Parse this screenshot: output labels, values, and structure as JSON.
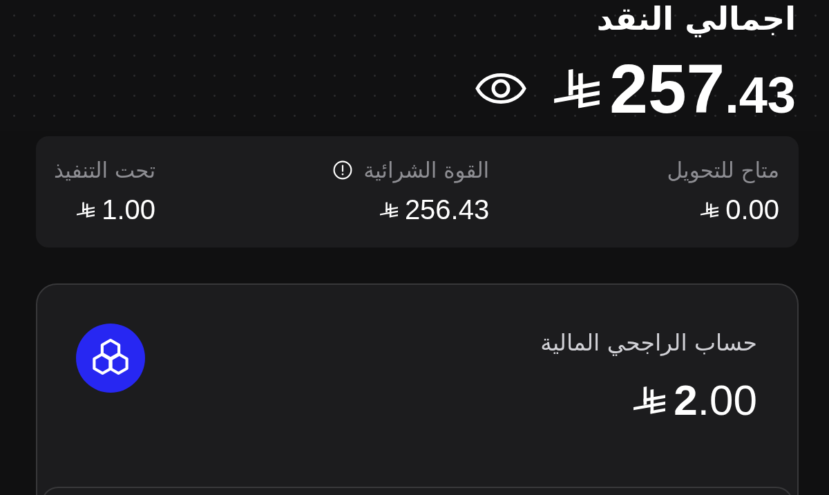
{
  "header": {
    "title": "اجمالي النقد",
    "total": {
      "integer": "257",
      "fraction": ".43"
    }
  },
  "summary": [
    {
      "label": "متاح للتحويل",
      "value": "0.00",
      "info": false
    },
    {
      "label": "القوة الشرائية",
      "value": "256.43",
      "info": true
    },
    {
      "label": "تحت التنفيذ",
      "value": "1.00",
      "info": false
    }
  ],
  "accounts": [
    {
      "name": "حساب الراجحي المالية",
      "amount": {
        "integer": "2",
        "fraction": ".00"
      }
    }
  ]
}
